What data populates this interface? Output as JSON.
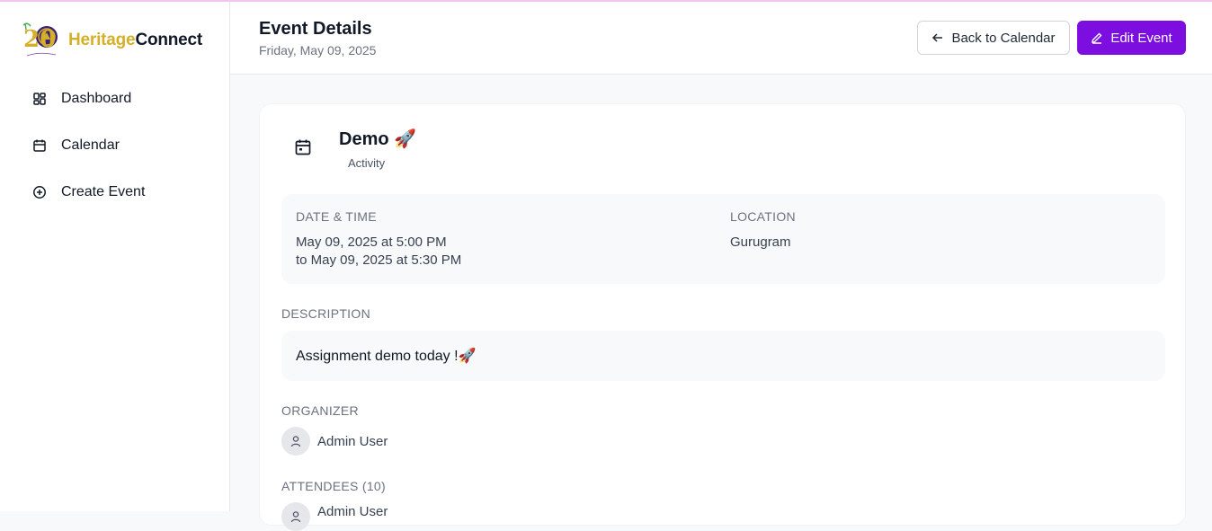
{
  "brand": {
    "name_part1": "Heritage",
    "name_part2": "Connect",
    "logo_number": "20",
    "accent_color": "#d4b02a"
  },
  "sidebar": {
    "items": [
      {
        "label": "Dashboard",
        "icon": "dashboard-icon"
      },
      {
        "label": "Calendar",
        "icon": "calendar-icon"
      },
      {
        "label": "Create Event",
        "icon": "plus-circle-icon"
      }
    ]
  },
  "header": {
    "title": "Event Details",
    "subtitle": "Friday, May 09, 2025",
    "back_label": "Back to Calendar",
    "edit_label": "Edit Event",
    "primary_color": "#7c0fe0"
  },
  "event": {
    "title": "Demo 🚀",
    "type": "Activity",
    "datetime_label": "DATE & TIME",
    "datetime_start": "May 09, 2025 at 5:00 PM",
    "datetime_end": "to May 09, 2025 at 5:30 PM",
    "location_label": "LOCATION",
    "location": "Gurugram",
    "description_label": "DESCRIPTION",
    "description": "Assignment demo today !🚀",
    "organizer_label": "ORGANIZER",
    "organizer": "Admin User",
    "attendees_label": "ATTENDEES (10)",
    "attendees": [
      "Admin User"
    ]
  }
}
